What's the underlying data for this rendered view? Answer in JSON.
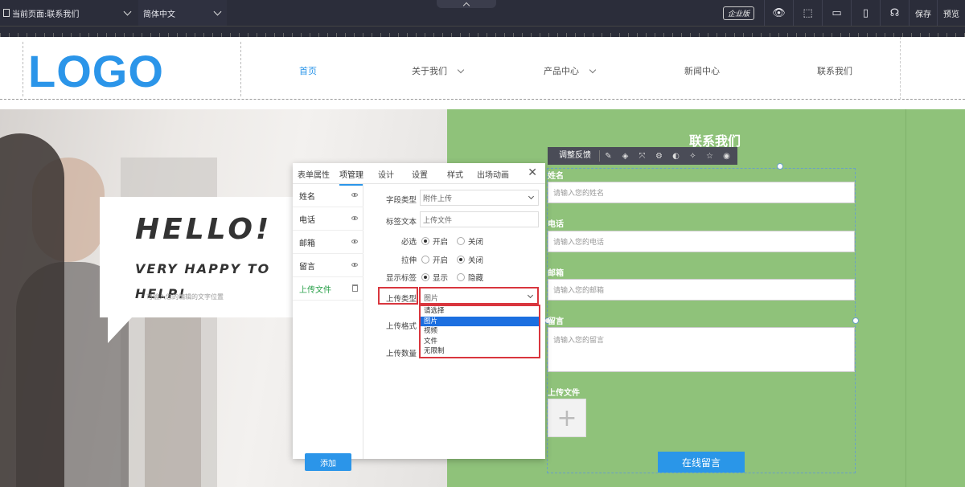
{
  "topbar": {
    "page_select": "当前页面:联系我们",
    "lang_select": "简体中文",
    "edition_badge": "企业版",
    "save": "保存",
    "preview": "预览",
    "icons": [
      "eye-icon",
      "select-icon",
      "desktop-icon",
      "mobile-icon",
      "support-icon"
    ]
  },
  "site": {
    "logo": "LOGO",
    "nav": [
      "首页",
      "关于我们",
      "产品中心",
      "新闻中心",
      "联系我们"
    ],
    "accent": "#2b95e9"
  },
  "hero": {
    "hello": "HELLO!",
    "tagline": "VERY HAPPY TO HELP!",
    "faint_text": "可输入您的编辑的文字位置"
  },
  "contact": {
    "title": "联系我们",
    "toolbar_label": "调整反馈",
    "fields": [
      {
        "label": "姓名",
        "placeholder": "请输入您的姓名"
      },
      {
        "label": "电话",
        "placeholder": "请输入您的电话"
      },
      {
        "label": "邮箱",
        "placeholder": "请输入您的邮箱"
      },
      {
        "label": "留言",
        "placeholder": "请输入您的留言"
      }
    ],
    "upload_label": "上传文件",
    "submit": "在线留言",
    "bg_color": "#8fc27a"
  },
  "panel": {
    "tabs": [
      "表单属性",
      "项管理",
      "设计",
      "设置",
      "样式",
      "出场动画"
    ],
    "active_tab": "项管理",
    "items": [
      "姓名",
      "电话",
      "邮箱",
      "留言",
      "上传文件"
    ],
    "active_item": "上传文件",
    "add_button": "添加",
    "props": {
      "field_type_label": "字段类型",
      "field_type_value": "附件上传",
      "tag_text_label": "标签文本",
      "tag_text_value": "上传文件",
      "required_label": "必选",
      "required_on": "开启",
      "required_off": "关闭",
      "stretch_label": "拉伸",
      "stretch_on": "开启",
      "stretch_off": "关闭",
      "show_label_label": "显示标签",
      "show_label_show": "显示",
      "show_label_hide": "隐藏",
      "upload_type_label": "上传类型",
      "upload_type_value": "图片",
      "upload_format_label": "上传格式",
      "upload_count_label": "上传数量"
    },
    "dropdown_options": [
      "请选择",
      "图片",
      "视频",
      "文件",
      "无限制"
    ],
    "dropdown_selected": "图片",
    "highlight_color": "#d9363e"
  }
}
